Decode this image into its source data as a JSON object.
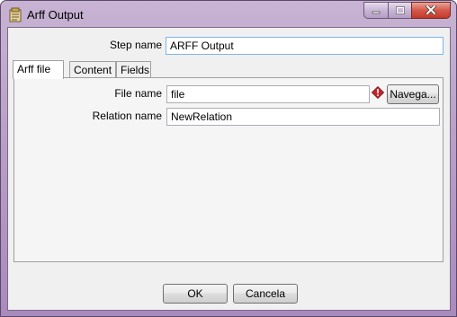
{
  "window": {
    "title": "Arff Output",
    "app_icon": "spoon-step-icon"
  },
  "titlebar_controls": {
    "minimize_icon": "minimize-icon",
    "maximize_icon": "maximize-icon",
    "close_icon": "close-icon"
  },
  "step_name": {
    "label": "Step name",
    "value": "ARFF Output"
  },
  "tabs": [
    {
      "label": "Arff file",
      "active": true
    },
    {
      "label": "Content",
      "active": false
    },
    {
      "label": "Fields",
      "active": false
    }
  ],
  "arff_file_tab": {
    "file_name_label": "File name",
    "file_name_value": "file",
    "browse_label": "Navega...",
    "relation_name_label": "Relation name",
    "relation_name_value": "NewRelation"
  },
  "buttons": {
    "ok_label": "OK",
    "cancel_label": "Cancela"
  },
  "colors": {
    "titlebar": "#b9a1c9",
    "client": "#f0f0f0",
    "warning": "#c0282b"
  }
}
